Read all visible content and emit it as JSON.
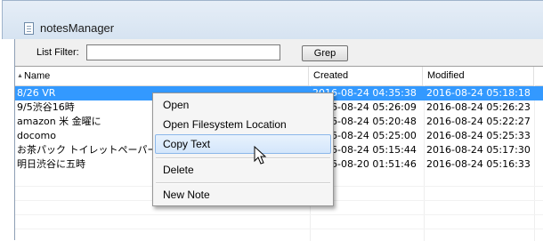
{
  "window": {
    "title": "notesManager",
    "icon": "notepad-icon"
  },
  "filter": {
    "label": "List Filter:",
    "value": "",
    "grep_label": "Grep"
  },
  "columns": {
    "name": "Name",
    "created": "Created",
    "modified": "Modified"
  },
  "rows": [
    {
      "name": "8/26  VR",
      "created": "2016-08-24  04:35:38",
      "modified": "2016-08-24  05:18:18",
      "selected": true
    },
    {
      "name": "9/5渋谷16時",
      "created": "2016-08-24  05:26:09",
      "modified": "2016-08-24  05:26:23"
    },
    {
      "name": "amazon 米  金曜に",
      "created": "2016-08-24  05:20:48",
      "modified": "2016-08-24  05:22:27"
    },
    {
      "name": "docomo",
      "created": "2016-08-24  05:25:00",
      "modified": "2016-08-24  05:25:33"
    },
    {
      "name": "お茶パック  トイレットペーパー",
      "created": "2016-08-24  05:15:44",
      "modified": "2016-08-24  05:17:30"
    },
    {
      "name": "明日渋谷に五時",
      "created": "2016-08-20  01:51:46",
      "modified": "2016-08-24  05:16:33"
    }
  ],
  "context_menu": {
    "items": [
      "Open",
      "Open Filesystem Location",
      "Copy Text",
      "Delete",
      "New Note"
    ],
    "highlighted": "Copy Text"
  },
  "colors": {
    "selection": "#3399ff",
    "menu_hover": "#d4e6fb"
  }
}
